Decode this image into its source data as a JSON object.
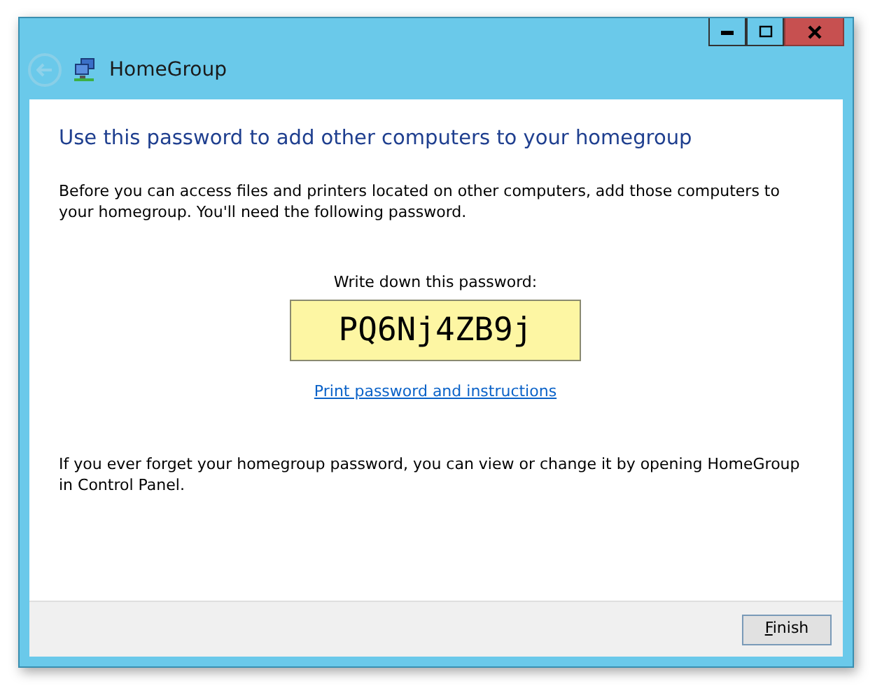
{
  "window": {
    "title": "HomeGroup",
    "back_button": {
      "disabled": true
    }
  },
  "heading": "Use this password to add other computers to your homegroup",
  "intro": "Before you can access files and printers located on other computers, add those computers to your homegroup. You'll need the following password.",
  "password_label": "Write down this password:",
  "password": "PQ6Nj4ZB9j",
  "print_link": "Print password and instructions",
  "footnote": "If you ever forget your homegroup password, you can view or change it by opening HomeGroup in Control Panel.",
  "buttons": [
    {
      "label": "Finish",
      "access_key_underlined": true
    }
  ]
}
